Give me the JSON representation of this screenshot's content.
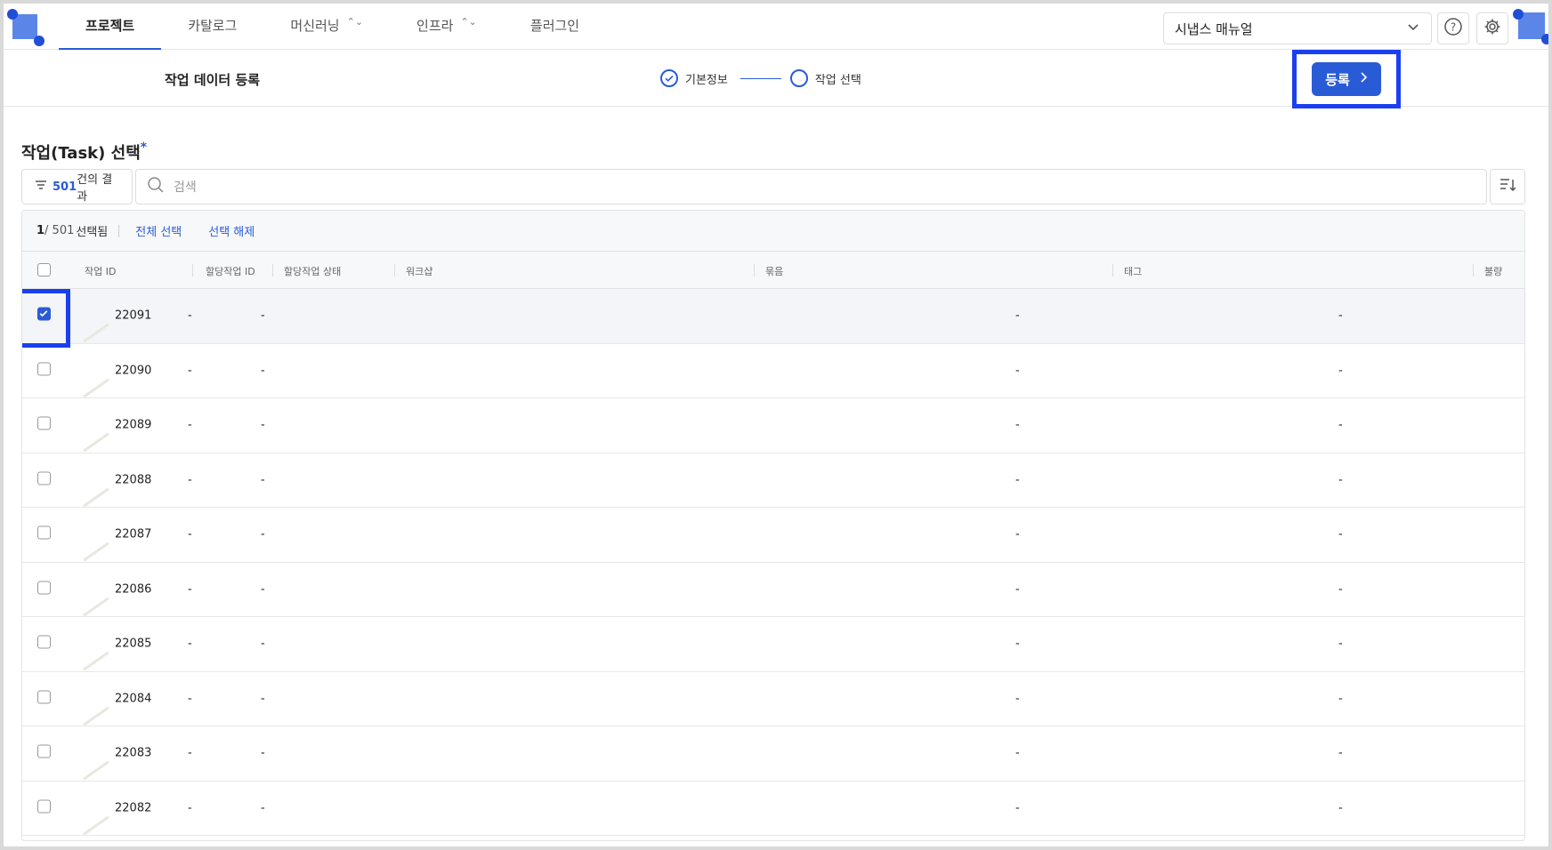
{
  "nav": {
    "tabs": [
      {
        "label": "프로젝트",
        "active": true
      },
      {
        "label": "카탈로그",
        "active": false
      },
      {
        "label": "머신러닝",
        "active": false,
        "has_caret": true
      },
      {
        "label": "인프라",
        "active": false,
        "has_caret": true
      },
      {
        "label": "플러그인",
        "active": false
      }
    ],
    "workspace": "시냅스 매뉴얼",
    "icons": [
      "help-icon",
      "gear-icon"
    ]
  },
  "subheader": {
    "title": "작업 데이터 등록",
    "steps": [
      {
        "label": "기본정보",
        "done": true
      },
      {
        "label": "작업 선택",
        "done": false
      }
    ],
    "register_label": "등록"
  },
  "section": {
    "title": "작업(Task) 선택",
    "required_mark": "*",
    "result_count": "501",
    "result_suffix": "건의 결과",
    "search_placeholder": "검색"
  },
  "selection": {
    "selected": "1",
    "total": "/ 501",
    "label": "선택됨",
    "select_all": "전체 선택",
    "deselect": "선택 해제"
  },
  "columns": [
    "작업 ID",
    "할당작업 ID",
    "할당작업 상태",
    "워크샵",
    "묶음",
    "태그",
    "불량"
  ],
  "rows": [
    {
      "id": "22091",
      "assign_id": "-",
      "assign_status": "-",
      "tag": "-",
      "defect": "-",
      "checked": true
    },
    {
      "id": "22090",
      "assign_id": "-",
      "assign_status": "-",
      "tag": "-",
      "defect": "-",
      "checked": false
    },
    {
      "id": "22089",
      "assign_id": "-",
      "assign_status": "-",
      "tag": "-",
      "defect": "-",
      "checked": false
    },
    {
      "id": "22088",
      "assign_id": "-",
      "assign_status": "-",
      "tag": "-",
      "defect": "-",
      "checked": false
    },
    {
      "id": "22087",
      "assign_id": "-",
      "assign_status": "-",
      "tag": "-",
      "defect": "-",
      "checked": false
    },
    {
      "id": "22086",
      "assign_id": "-",
      "assign_status": "-",
      "tag": "-",
      "defect": "-",
      "checked": false
    },
    {
      "id": "22085",
      "assign_id": "-",
      "assign_status": "-",
      "tag": "-",
      "defect": "-",
      "checked": false
    },
    {
      "id": "22084",
      "assign_id": "-",
      "assign_status": "-",
      "tag": "-",
      "defect": "-",
      "checked": false
    },
    {
      "id": "22083",
      "assign_id": "-",
      "assign_status": "-",
      "tag": "-",
      "defect": "-",
      "checked": false
    },
    {
      "id": "22082",
      "assign_id": "-",
      "assign_status": "-",
      "tag": "-",
      "defect": "-",
      "checked": false
    }
  ],
  "colors": {
    "accent": "#2a5bd7",
    "highlight": "#1a3ff0"
  }
}
